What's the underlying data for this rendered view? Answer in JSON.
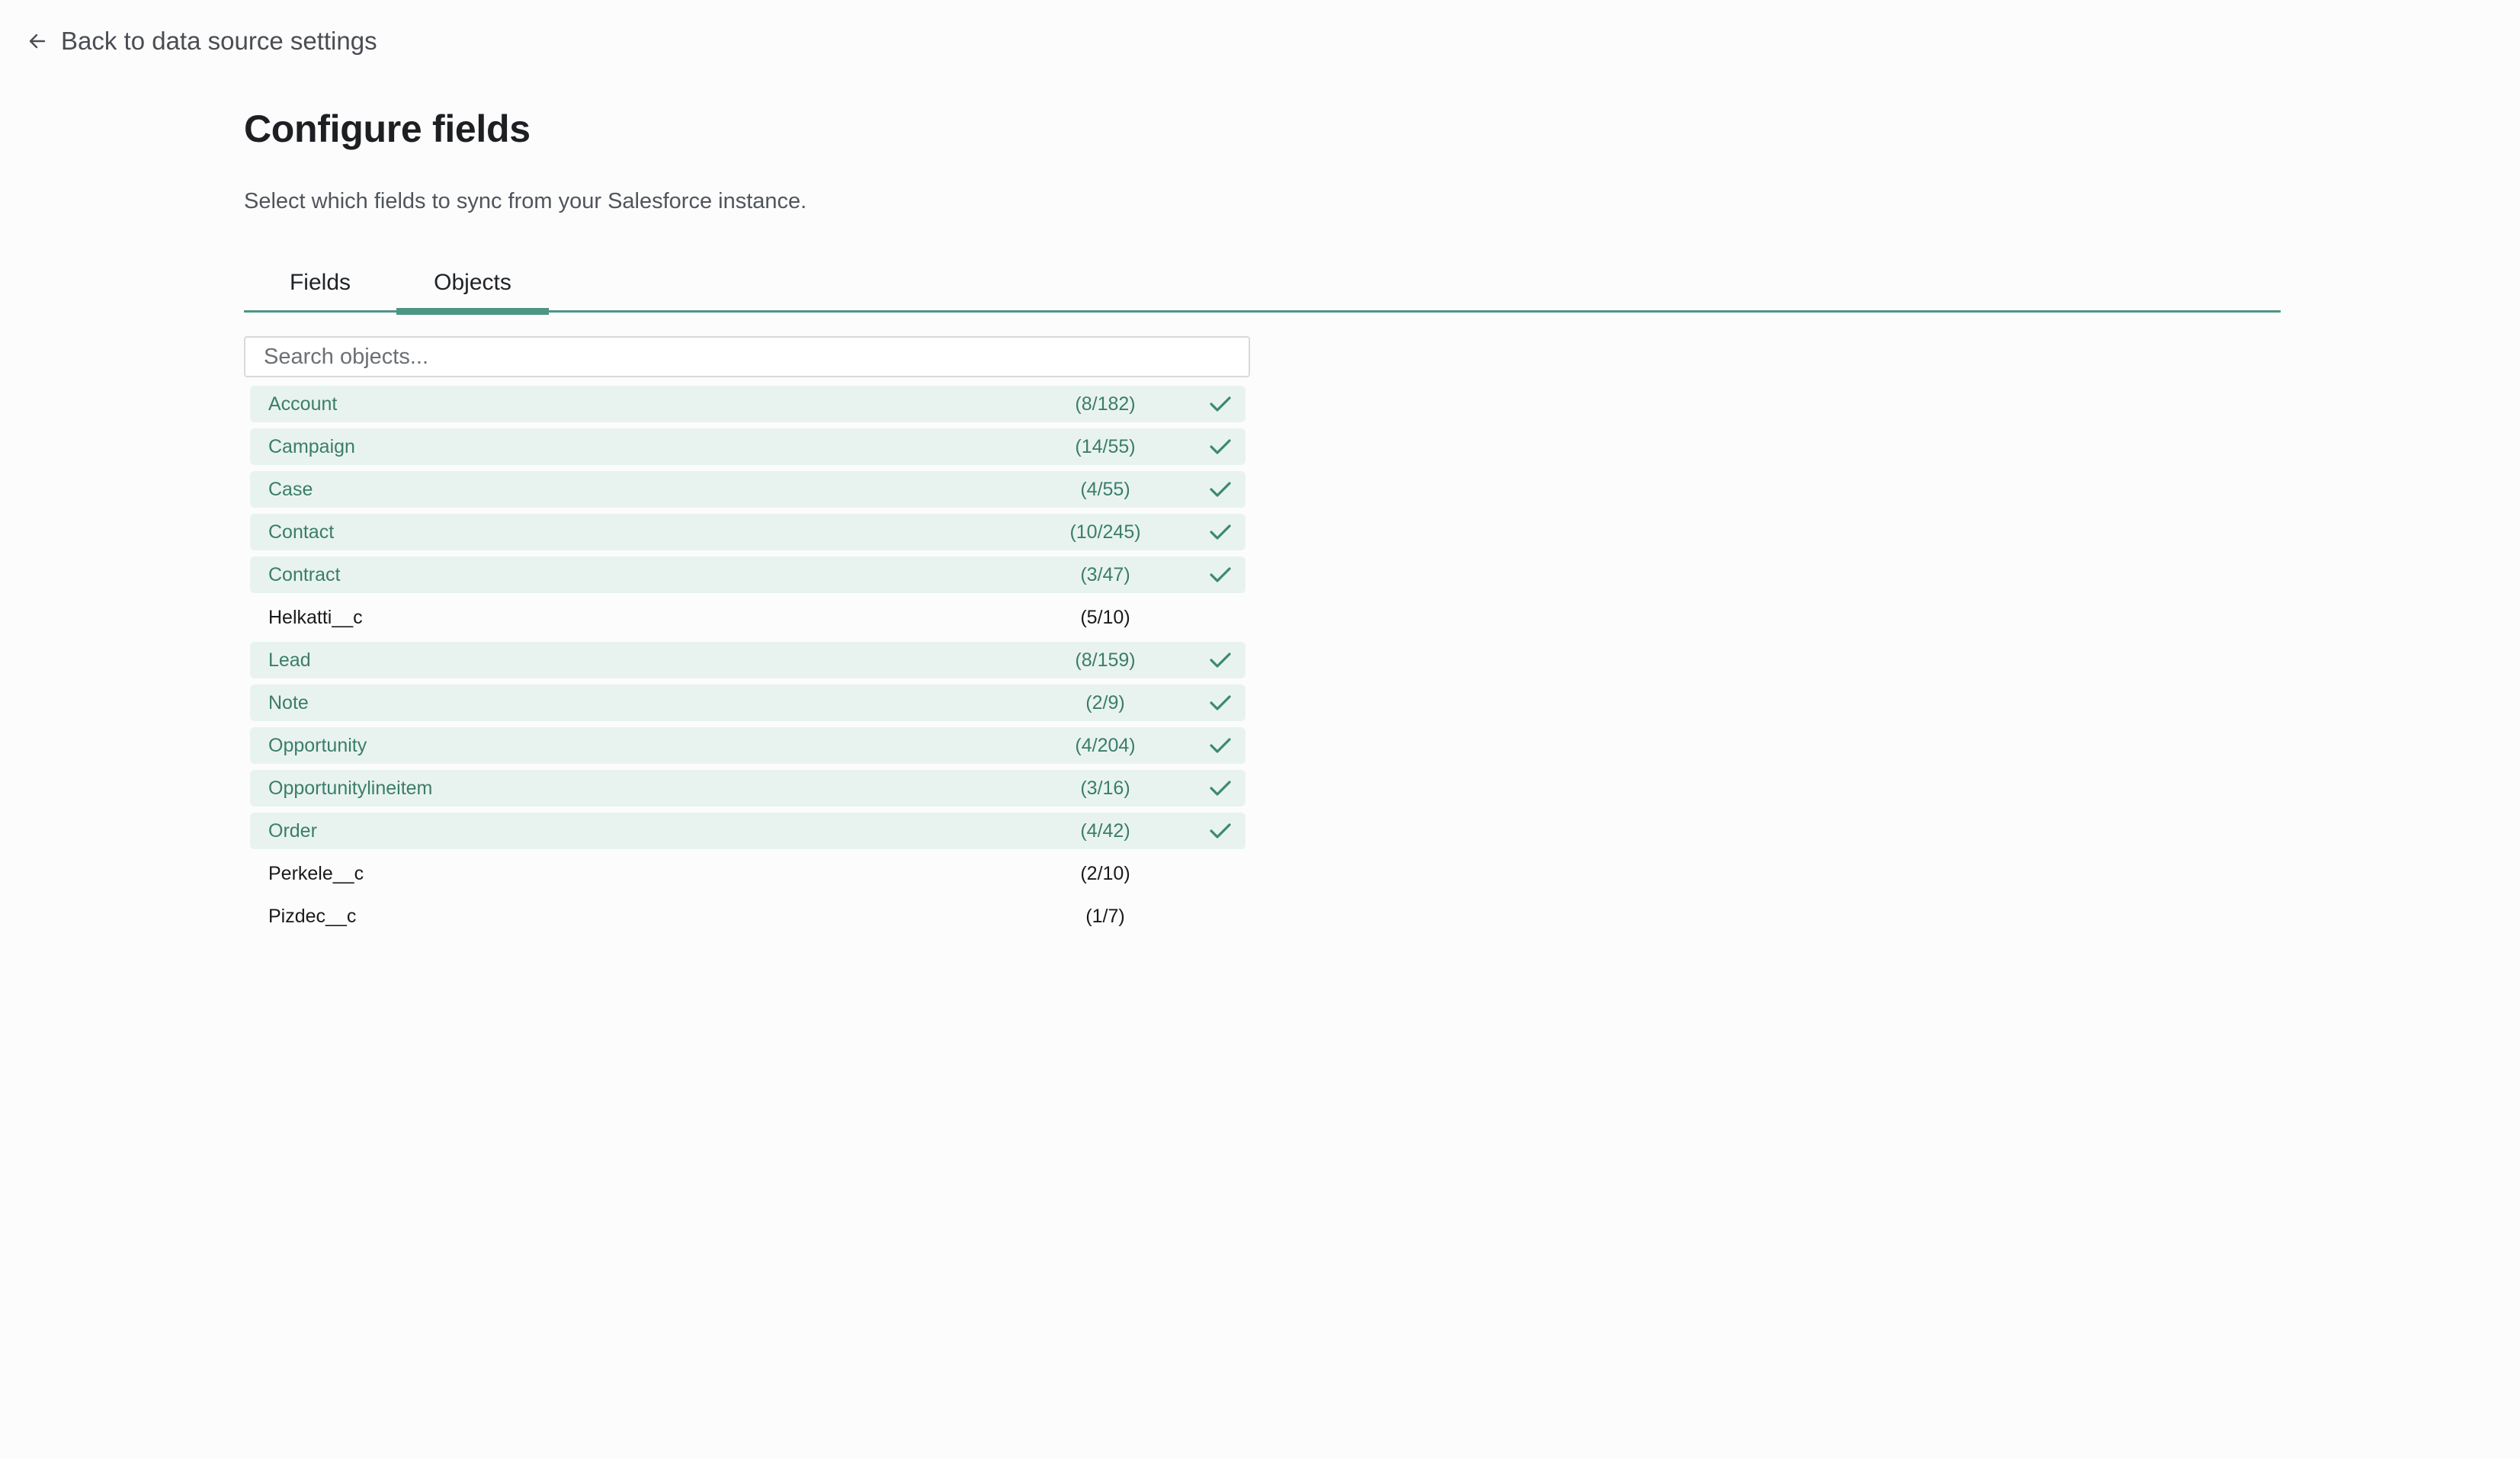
{
  "nav": {
    "back_label": "Back to data source settings"
  },
  "header": {
    "title": "Configure fields",
    "subtitle": "Select which fields to sync from your Salesforce instance."
  },
  "tabs": [
    {
      "label": "Fields",
      "active": false
    },
    {
      "label": "Objects",
      "active": true
    }
  ],
  "search": {
    "placeholder": "Search objects...",
    "value": ""
  },
  "objects": [
    {
      "name": "Account",
      "count": "(8/182)",
      "selected": true
    },
    {
      "name": "Campaign",
      "count": "(14/55)",
      "selected": true
    },
    {
      "name": "Case",
      "count": "(4/55)",
      "selected": true
    },
    {
      "name": "Contact",
      "count": "(10/245)",
      "selected": true
    },
    {
      "name": "Contract",
      "count": "(3/47)",
      "selected": true
    },
    {
      "name": "Helkatti__c",
      "count": "(5/10)",
      "selected": false
    },
    {
      "name": "Lead",
      "count": "(8/159)",
      "selected": true
    },
    {
      "name": "Note",
      "count": "(2/9)",
      "selected": true
    },
    {
      "name": "Opportunity",
      "count": "(4/204)",
      "selected": true
    },
    {
      "name": "Opportunitylineitem",
      "count": "(3/16)",
      "selected": true
    },
    {
      "name": "Order",
      "count": "(4/42)",
      "selected": true
    },
    {
      "name": "Perkele__c",
      "count": "(2/10)",
      "selected": false
    },
    {
      "name": "Pizdec__c",
      "count": "(1/7)",
      "selected": false
    }
  ],
  "colors": {
    "accent": "#4d9684",
    "selected_row_bg": "#e8f3ef",
    "selected_text": "#3b7d6a",
    "check": "#3a8a72"
  },
  "icons": {
    "back": "arrow-left-icon",
    "selected": "check-icon"
  }
}
